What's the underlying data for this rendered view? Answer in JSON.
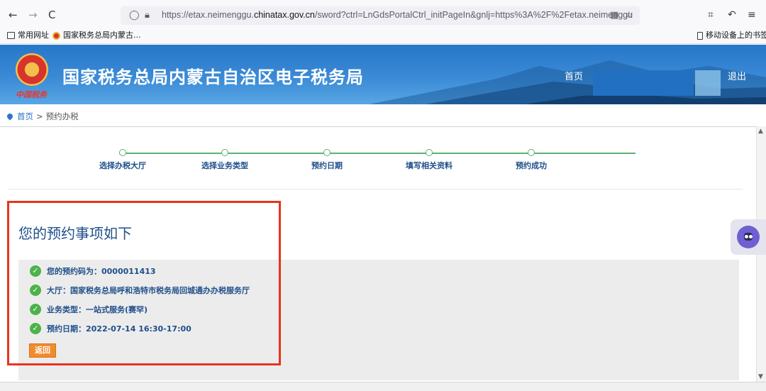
{
  "browser": {
    "back": "←",
    "forward": "→",
    "reload": "C",
    "url_prefix": "https://etax.neimenggu.",
    "url_domain": "chinatax.gov.cn",
    "url_suffix": "/sword?ctrl=LnGdsPortalCtrl_initPageIn&gnlj=https%3A%2F%2Fetax.neimenggu",
    "bookmarks": [
      "常用网址",
      "国家税务总局内蒙古..."
    ],
    "mobile_bookmarks": "移动设备上的书签"
  },
  "header": {
    "site_title": "国家税务总局内蒙古自治区电子税务局",
    "nav_home": "首页",
    "nav_logout": "退出"
  },
  "breadcrumb": {
    "home": "首页",
    "separator": ">",
    "current": "预约办税"
  },
  "steps": [
    "选择办税大厅",
    "选择业务类型",
    "预约日期",
    "填写相关资料",
    "预约成功"
  ],
  "result": {
    "title": "您的预约事项如下",
    "items": [
      "您的预约码为：0000011413",
      "大厅：国家税务总局呼和浩特市税务局回城通办办税服务厅",
      "业务类型：一站式服务(赛罕)",
      "预约日期：2022-07-14 16:30-17:00"
    ],
    "back_label": "返回"
  },
  "colors": {
    "banner": "#2777c9",
    "step_line": "#5cb270",
    "title_text": "#1f4f8a",
    "check": "#4cb24a",
    "back_button": "#f08c2b",
    "highlight": "#e8341c"
  }
}
